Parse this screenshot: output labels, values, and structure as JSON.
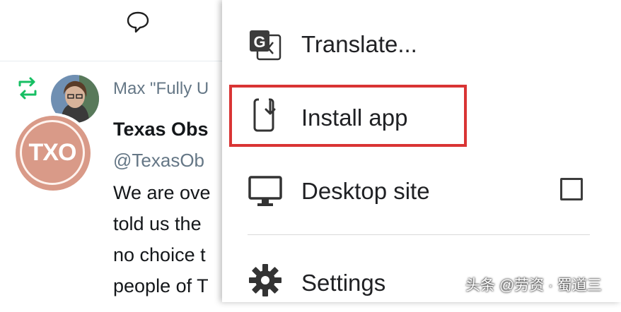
{
  "tweet": {
    "retweeter_text": "Max \"Fully U",
    "author_name": "Texas Obs",
    "handle": "@TexasOb",
    "avatar_text": "TXO",
    "body_lines": [
      "We are ove",
      "told us the",
      "no choice t",
      "people of T"
    ]
  },
  "menu": {
    "items": [
      {
        "label": "Translate...",
        "icon": "translate-icon"
      },
      {
        "label": "Install app",
        "icon": "install-app-icon"
      },
      {
        "label": "Desktop site",
        "icon": "desktop-icon",
        "checked": false
      },
      {
        "label": "Settings",
        "icon": "gear-icon"
      }
    ]
  },
  "highlight_color": "#d93434",
  "watermark": "头条 @劳资 · 蜀道三"
}
